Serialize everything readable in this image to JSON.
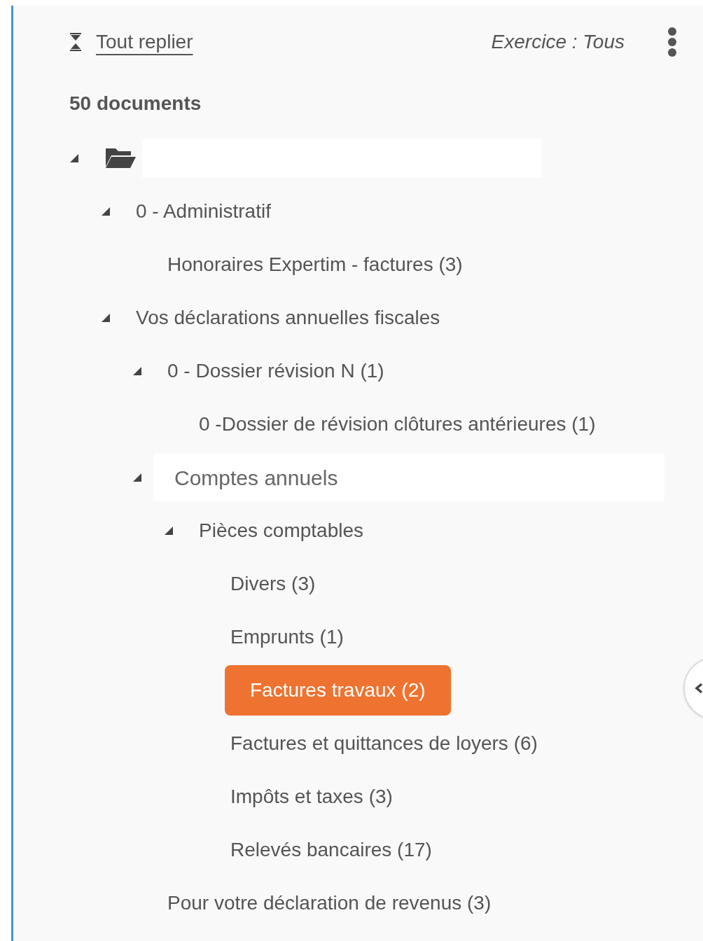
{
  "toolbar": {
    "collapse_all": "Tout replier",
    "filter": "Exercice : Tous"
  },
  "count": "50 documents",
  "tree": {
    "expanded": true,
    "children": [
      {
        "label": "0 - Administratif",
        "expanded": true,
        "selected": false,
        "hovered": false,
        "children": [
          {
            "label": "Honoraires Expertim - factures (3)",
            "selected": false,
            "hovered": false
          }
        ]
      },
      {
        "label": "Vos déclarations annuelles fiscales",
        "expanded": true,
        "selected": false,
        "hovered": false,
        "children": [
          {
            "label": "0 - Dossier révision N (1)",
            "expanded": true,
            "selected": false,
            "hovered": false,
            "children": [
              {
                "label": "0 -Dossier de révision clôtures antérieures (1)",
                "selected": false,
                "hovered": false
              }
            ]
          },
          {
            "label": "Comptes annuels",
            "expanded": true,
            "selected": false,
            "hovered": true,
            "children": [
              {
                "label": "Pièces comptables",
                "expanded": true,
                "selected": false,
                "hovered": false,
                "children": [
                  {
                    "label": "Divers (3)",
                    "selected": false,
                    "hovered": false
                  },
                  {
                    "label": "Emprunts (1)",
                    "selected": false,
                    "hovered": false
                  },
                  {
                    "label": "Factures travaux (2)",
                    "selected": true,
                    "hovered": false
                  },
                  {
                    "label": "Factures et quittances de loyers (6)",
                    "selected": false,
                    "hovered": false
                  },
                  {
                    "label": "Impôts et taxes (3)",
                    "selected": false,
                    "hovered": false
                  },
                  {
                    "label": "Relevés bancaires (17)",
                    "selected": false,
                    "hovered": false
                  }
                ]
              }
            ]
          },
          {
            "label": "Pour votre déclaration de revenus (3)",
            "selected": false,
            "hovered": false
          }
        ]
      }
    ]
  }
}
